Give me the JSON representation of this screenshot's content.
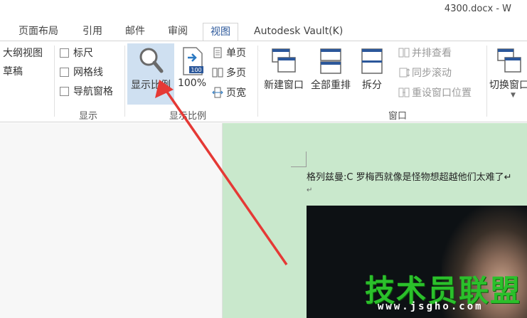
{
  "window": {
    "title": "4300.docx - W"
  },
  "tabs": [
    {
      "label": "页面布局"
    },
    {
      "label": "引用"
    },
    {
      "label": "邮件"
    },
    {
      "label": "审阅"
    },
    {
      "label": "视图"
    },
    {
      "label": "Autodesk Vault(K)"
    }
  ],
  "ribbon": {
    "views": {
      "outline": "大纲视图",
      "draft": "草稿"
    },
    "show": {
      "ruler": "标尺",
      "gridlines": "网格线",
      "navpane": "导航窗格",
      "group": "显示"
    },
    "zoom": {
      "zoom_button": "显示比例",
      "hundred": "100%",
      "one_page": "单页",
      "multi_page": "多页",
      "page_width": "页宽",
      "group": "显示比例"
    },
    "window": {
      "new_window": "新建窗口",
      "arrange_all": "全部重排",
      "split": "拆分",
      "side_by_side": "并排查看",
      "sync_scroll": "同步滚动",
      "reset_position": "重设窗口位置",
      "switch_windows": "切换窗口",
      "group": "窗口"
    }
  },
  "document": {
    "paragraph": "格列兹曼:C 罗梅西就像是怪物想超越他们太难了↵",
    "paragraph_mark": "↵",
    "watermark": "技术员联盟",
    "watermark_url": "www.jsgho.com"
  },
  "colors": {
    "accent": "#2b579a",
    "page_bg": "#c9e8cc",
    "arrow": "#e53935",
    "watermark": "#2bc02b"
  }
}
